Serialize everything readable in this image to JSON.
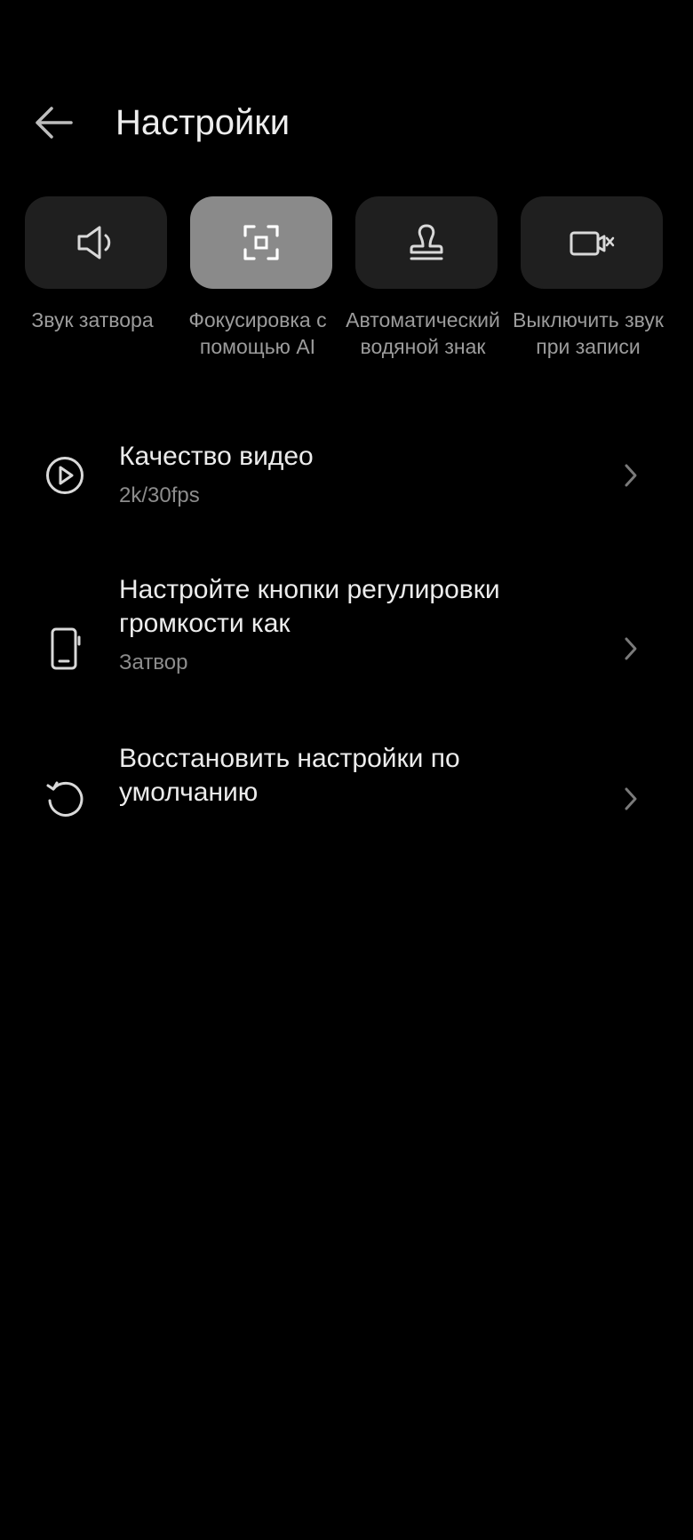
{
  "header": {
    "title": "Настройки"
  },
  "toggles": [
    {
      "label": "Звук затвора",
      "icon": "speaker-icon",
      "active": false
    },
    {
      "label": "Фокусировка с помощью AI",
      "icon": "focus-frame-icon",
      "active": true
    },
    {
      "label": "Автоматический водяной знак",
      "icon": "stamp-icon",
      "active": false
    },
    {
      "label": "Выключить звук при записи",
      "icon": "video-mute-icon",
      "active": false
    }
  ],
  "settings": [
    {
      "title": "Качество видео",
      "subtitle": "2k/30fps",
      "icon": "play-circle-icon"
    },
    {
      "title": "Настройте кнопки регулировки громкости как",
      "subtitle": "Затвор",
      "icon": "phone-side-button-icon"
    },
    {
      "title": "Восстановить настройки по умолчанию",
      "icon": "reset-icon"
    }
  ],
  "colors": {
    "background": "#000000",
    "tile": "#1f1f1f",
    "tile_active": "#8a8a8a",
    "text_primary": "#ececec",
    "text_secondary": "#8c8c8c"
  }
}
